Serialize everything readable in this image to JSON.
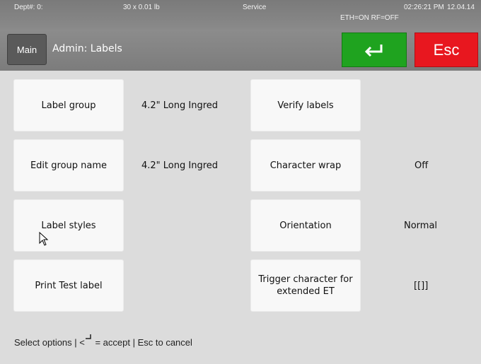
{
  "status": {
    "dept": "Dept#: 0:",
    "weight": "30 x 0.01 lb",
    "mode": "Service",
    "network": "ETH=ON  RF=OFF",
    "time": "02:26:21 PM",
    "date": "12.04.14"
  },
  "header": {
    "main_label": "Main",
    "title": "Admin: Labels",
    "enter_icon": "enter-arrow",
    "esc_label": "Esc",
    "colors": {
      "enter": "#1fa31f",
      "esc": "#e8171f"
    }
  },
  "options": [
    {
      "label": "Label group",
      "value": "4.2\" Long Ingred"
    },
    {
      "label": "Edit group name",
      "value": "4.2\" Long Ingred"
    },
    {
      "label": "Label styles",
      "value": ""
    },
    {
      "label": "Print Test label",
      "value": ""
    },
    {
      "label": "Verify labels",
      "value": ""
    },
    {
      "label": "Character wrap",
      "value": "Off"
    },
    {
      "label": "Orientation",
      "value": "Normal"
    },
    {
      "label": "Trigger character for extended ET",
      "value": "[[]]"
    }
  ],
  "footer": {
    "text_before": "Select options | <",
    "text_after": " = accept | Esc to cancel"
  }
}
